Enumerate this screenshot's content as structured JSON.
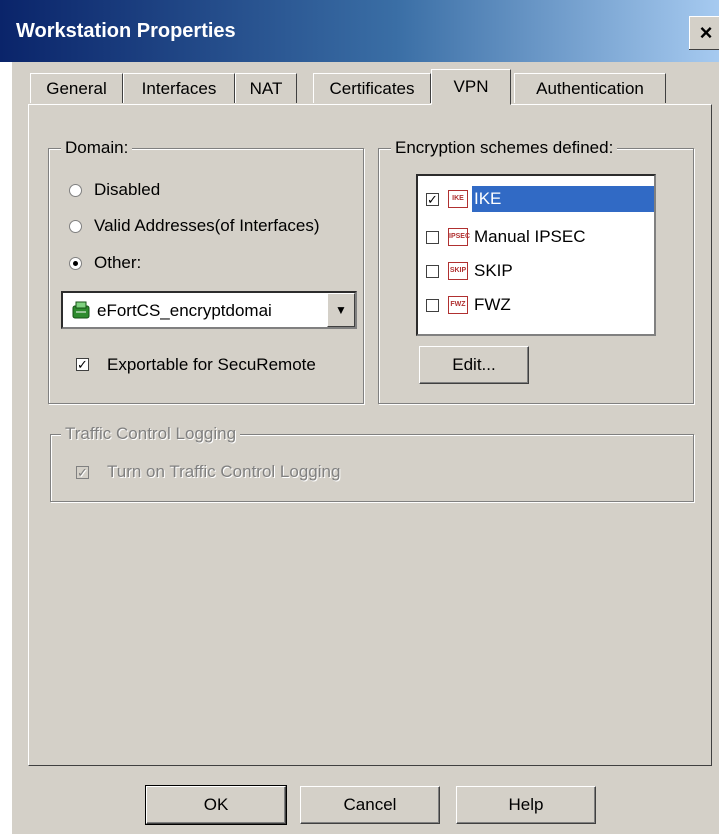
{
  "window": {
    "title": "Workstation Properties",
    "close_label": "×"
  },
  "tabs": [
    {
      "label": "General"
    },
    {
      "label": "Interfaces"
    },
    {
      "label": "NAT"
    },
    {
      "label": "Certificates"
    },
    {
      "label": "VPN",
      "active": true
    },
    {
      "label": "Authentication"
    }
  ],
  "domain": {
    "group_label": "Domain:",
    "options": [
      {
        "label": "Disabled",
        "selected": false
      },
      {
        "label": "Valid Addresses(of Interfaces)",
        "selected": false
      },
      {
        "label": "Other:",
        "selected": true
      }
    ],
    "select_value": "eFortCS_encryptdomai",
    "exportable_label": "Exportable for SecuRemote",
    "exportable_checked": true
  },
  "encryption": {
    "group_label": "Encryption schemes defined:",
    "schemes": [
      {
        "label": "IKE",
        "icon_text": "IKE",
        "checked": true,
        "selected": true
      },
      {
        "label": "Manual IPSEC",
        "icon_text": "IPSEC",
        "checked": false,
        "selected": false
      },
      {
        "label": "SKIP",
        "icon_text": "SKIP",
        "checked": false,
        "selected": false
      },
      {
        "label": "FWZ",
        "icon_text": "FWZ",
        "checked": false,
        "selected": false
      }
    ],
    "edit_label": "Edit..."
  },
  "traffic": {
    "group_label": "Traffic Control Logging",
    "checkbox_label": "Turn on Traffic Control Logging",
    "checked": true,
    "enabled": false
  },
  "buttons": {
    "ok": "OK",
    "cancel": "Cancel",
    "help": "Help"
  },
  "colors": {
    "title_bar": "#0a246a",
    "dialog_bg": "#d4d0c8",
    "selection": "#316ac5"
  }
}
